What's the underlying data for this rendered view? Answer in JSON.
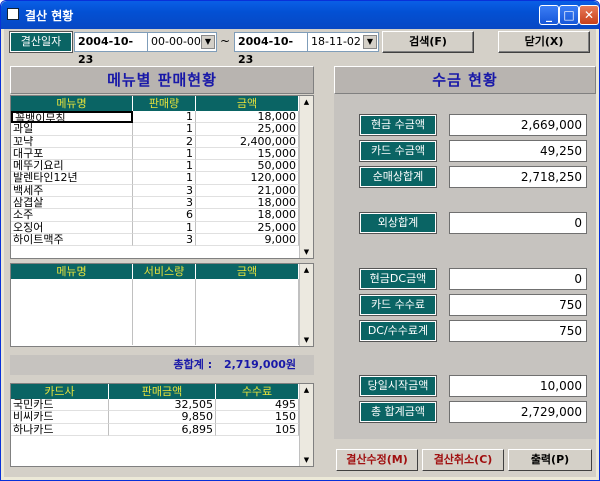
{
  "window": {
    "title": "결산 현황"
  },
  "search": {
    "label": "결산일자",
    "from_date": "2004-10-23",
    "from_time": "00-00-00",
    "tilde": "~",
    "to_date": "2004-10-23",
    "to_time": "18-11-02",
    "search_button": "검색(F)",
    "close_button": "닫기(X)"
  },
  "menu_sales": {
    "title": "메뉴별  판매현황",
    "columns": [
      "메뉴명",
      "판매량",
      "금액"
    ],
    "rows": [
      [
        "꼴뱅이무침",
        "1",
        "18,000"
      ],
      [
        "과일",
        "1",
        "25,000"
      ],
      [
        "꼬냑",
        "2",
        "2,400,000"
      ],
      [
        "대구포",
        "1",
        "15,000"
      ],
      [
        "메뚜기요리",
        "1",
        "50,000"
      ],
      [
        "발렌타인12년",
        "1",
        "120,000"
      ],
      [
        "백세주",
        "3",
        "21,000"
      ],
      [
        "삼겹살",
        "3",
        "18,000"
      ],
      [
        "소주",
        "6",
        "18,000"
      ],
      [
        "오징어",
        "1",
        "25,000"
      ],
      [
        "하이트맥주",
        "3",
        "9,000"
      ]
    ]
  },
  "service": {
    "columns": [
      "메뉴명",
      "서비스량",
      "금액"
    ]
  },
  "total": {
    "label": "총합계 :",
    "value": "2,719,000원"
  },
  "cards": {
    "columns": [
      "카드사",
      "판매금액",
      "수수료"
    ],
    "rows": [
      [
        "국민카드",
        "32,505",
        "495"
      ],
      [
        "비씨카드",
        "9,850",
        "150"
      ],
      [
        "하나카드",
        "6,895",
        "105"
      ]
    ]
  },
  "collection": {
    "title": "수금  현황",
    "items": [
      {
        "label": "현금 수금액",
        "value": "2,669,000"
      },
      {
        "label": "카드 수금액",
        "value": "49,250"
      },
      {
        "label": "순매상합계",
        "value": "2,718,250"
      },
      {
        "label": "외상합계",
        "value": "0"
      },
      {
        "label": "현금DC금액",
        "value": "0"
      },
      {
        "label": "카드 수수료",
        "value": "750"
      },
      {
        "label": "DC/수수료계",
        "value": "750"
      },
      {
        "label": "당일시작금액",
        "value": "10,000"
      },
      {
        "label": "총 합계금액",
        "value": "2,729,000"
      }
    ]
  },
  "buttons": {
    "settle_edit": "결산수정(M)",
    "settle_cancel": "결산취소(C)",
    "print": "출력(P)"
  },
  "colors": {
    "header_bg": "#0a6464",
    "header_text": "#e6e23c",
    "title_text": "#1818a8",
    "title_bar": "#0350d3"
  }
}
